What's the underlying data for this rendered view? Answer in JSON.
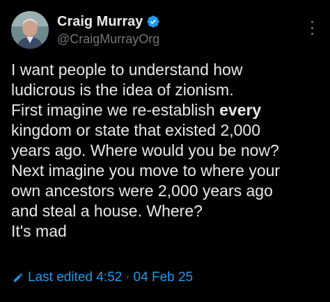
{
  "author": {
    "display_name": "Craig Murray",
    "handle": "@CraigMurrayOrg",
    "verified": true,
    "verified_color": "#1d9bf0"
  },
  "tweet": {
    "lines": [
      {
        "before": "I want people to understand how",
        "bold": "",
        "after": ""
      },
      {
        "before": "ludicrous is the idea of zionism.",
        "bold": "",
        "after": ""
      },
      {
        "before": "First imagine we re-establish ",
        "bold": "every",
        "after": ""
      },
      {
        "before": "kingdom or state that existed 2,000",
        "bold": "",
        "after": ""
      },
      {
        "before": "years ago. Where would you be now?",
        "bold": "",
        "after": ""
      },
      {
        "before": "Next imagine you move to where your",
        "bold": "",
        "after": ""
      },
      {
        "before": "own ancestors were 2,000 years ago",
        "bold": "",
        "after": ""
      },
      {
        "before": "and steal a house. Where?",
        "bold": "",
        "after": ""
      },
      {
        "before": "It's mad",
        "bold": "",
        "after": ""
      }
    ]
  },
  "edit_info": {
    "label": "Last edited 4:52",
    "separator": "·",
    "date": "04 Feb 25",
    "icon": "pencil-icon",
    "color": "#1d9bf0"
  },
  "menu": {
    "icon": "more-options-icon"
  }
}
